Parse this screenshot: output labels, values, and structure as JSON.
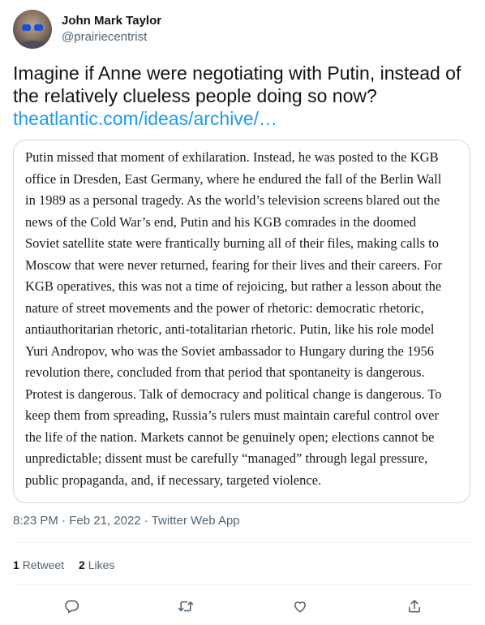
{
  "author": {
    "display_name": "John Mark Taylor",
    "handle": "@prairiecentrist",
    "avatar_icon": "profile-photo"
  },
  "tweet": {
    "text_line1": "Imagine if Anne were negotiating with Putin, instead of",
    "text_line2": "the relatively clueless people doing so now?",
    "link": "theatlantic.com/ideas/archive/…",
    "link_color": "#1d9bf0"
  },
  "quote": {
    "lines": [
      "Putin missed that moment of exhilaration. Instead, he was posted to the KGB",
      "office in Dresden, East Germany, where he endured the fall of the Berlin Wall",
      "in 1989 as a personal tragedy. As the world’s television screens blared out the",
      "news of the Cold War’s end, Putin and his KGB comrades in the doomed",
      "Soviet satellite state were frantically burning all of their files, making calls to",
      "Moscow that were never returned, fearing for their lives and their careers. For",
      "KGB operatives, this was not a time of rejoicing, but rather a lesson about the",
      "nature of street movements and the power of rhetoric: democratic rhetoric,",
      "antiauthoritarian rhetoric, anti-totalitarian rhetoric. Putin, like his role model",
      "Yuri Andropov, who was the Soviet ambassador to Hungary during the 1956",
      "revolution there, concluded from that period that spontaneity is dangerous.",
      "Protest is dangerous. Talk of democracy and political change is dangerous. To",
      "keep them from spreading, Russia’s rulers must maintain careful control over",
      "the life of the nation. Markets cannot be genuinely open; elections cannot be",
      "unpredictable; dissent must be carefully “managed” through legal pressure,",
      "public propaganda, and, if necessary, targeted violence."
    ]
  },
  "meta": {
    "time": "8:23 PM",
    "separator": " · ",
    "date": "Feb 21, 2022",
    "source": "Twitter Web App"
  },
  "stats": {
    "retweets_count": "1",
    "retweets_label": "Retweet",
    "likes_count": "2",
    "likes_label": "Likes"
  },
  "actions": {
    "reply_icon": "reply-icon",
    "retweet_icon": "retweet-icon",
    "like_icon": "heart-icon",
    "share_icon": "share-icon",
    "icon_color": "#536471"
  }
}
